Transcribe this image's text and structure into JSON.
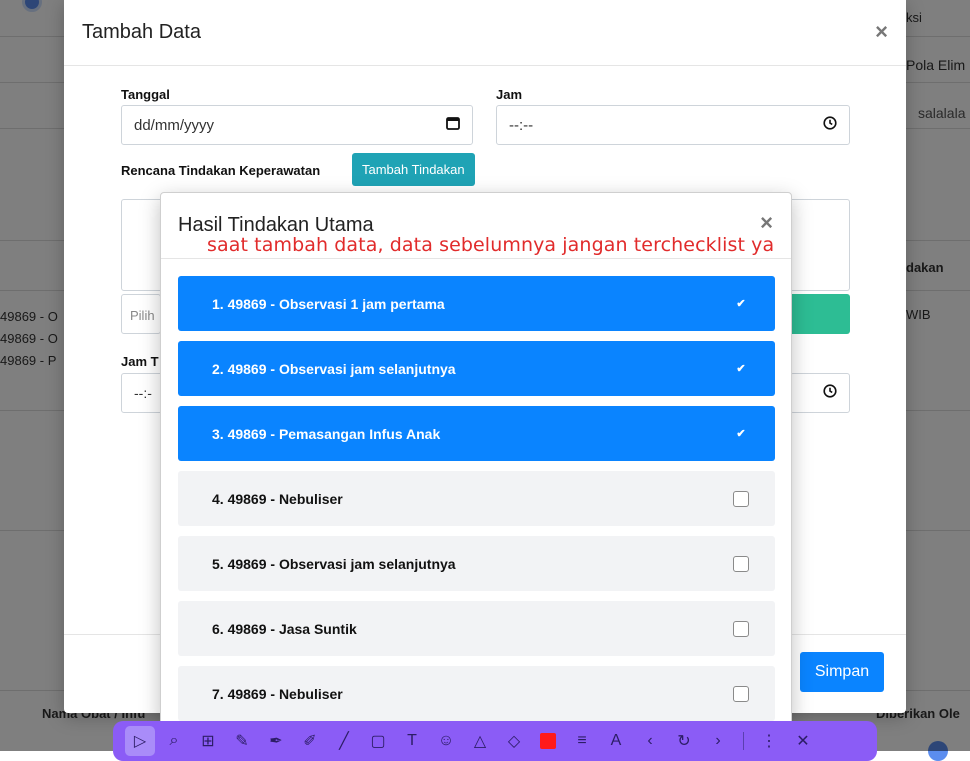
{
  "background": {
    "right_texts": [
      "ksi",
      "Pola Elim",
      "salalala",
      "dakan",
      "WIB",
      "Diberikan Ole"
    ],
    "left_list": [
      "49869 - O",
      "49869 - O",
      "49869 - P"
    ],
    "bottom_left_text": "Nama Obat / Infu"
  },
  "main_modal": {
    "title": "Tambah Data",
    "tanggal_label": "Tanggal",
    "tanggal_placeholder": "dd/mm/yyyy",
    "jam_label": "Jam",
    "jam_placeholder": "--:--",
    "rencana_label": "Rencana Tindakan Keperawatan",
    "tambah_tindakan_button": "Tambah Tindakan",
    "pilih_placeholder": "Pilih",
    "jam_t_label": "Jam T",
    "jam_t_placeholder": "--:-",
    "simpan_button": "Simpan"
  },
  "sub_modal": {
    "title": "Hasil Tindakan Utama",
    "annotation": "saat tambah data, data sebelumnya jangan terchecklist ya",
    "items": [
      {
        "label": "1. 49869 - Observasi 1 jam pertama",
        "checked": true
      },
      {
        "label": "2. 49869 - Observasi jam selanjutnya",
        "checked": true
      },
      {
        "label": "3. 49869 - Pemasangan Infus Anak",
        "checked": true
      },
      {
        "label": "4. 49869 - Nebuliser",
        "checked": false
      },
      {
        "label": "5. 49869 - Observasi jam selanjutnya",
        "checked": false
      },
      {
        "label": "6. 49869 - Jasa Suntik",
        "checked": false
      },
      {
        "label": "7. 49869 - Nebuliser",
        "checked": false
      }
    ]
  },
  "colors": {
    "primary_blue": "#0a84ff",
    "teal": "#1fa3b5",
    "green": "#2dbd94",
    "annotation_red": "#e12b2b",
    "toolbar_purple": "#8b5cf6"
  },
  "icons": {
    "calendar": "calendar-icon",
    "clock": "clock-icon",
    "close": "close-icon",
    "check": "check-icon"
  }
}
